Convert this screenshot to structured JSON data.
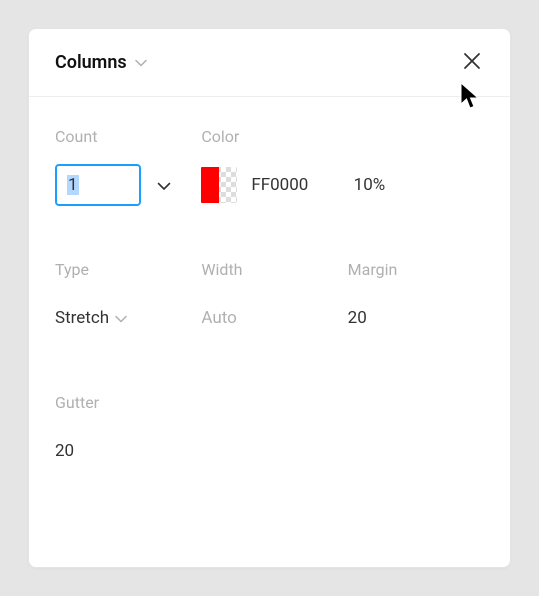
{
  "panel": {
    "title": "Columns"
  },
  "fields": {
    "count": {
      "label": "Count",
      "value": "1"
    },
    "color": {
      "label": "Color",
      "hex": "FF0000",
      "swatch_color": "#FF0000",
      "opacity": "10%"
    },
    "type": {
      "label": "Type",
      "value": "Stretch"
    },
    "width": {
      "label": "Width",
      "value": "Auto"
    },
    "margin": {
      "label": "Margin",
      "value": "20"
    },
    "gutter": {
      "label": "Gutter",
      "value": "20"
    }
  }
}
